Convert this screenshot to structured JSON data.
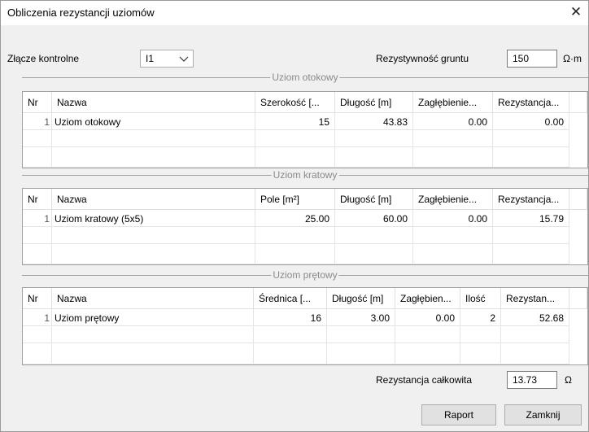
{
  "window": {
    "title": "Obliczenia rezystancji uziomów",
    "close_glyph": "✕"
  },
  "top": {
    "joint_label": "Złącze kontrolne",
    "joint_value": "I1",
    "resistivity_label": "Rezystywność gruntu",
    "resistivity_value": "150",
    "resistivity_unit": "Ω·m"
  },
  "otokowy": {
    "caption": "Uziom otokowy",
    "headers": [
      "Nr",
      "Nazwa",
      "Szerokość [...",
      "Długość [m]",
      "Zagłębienie...",
      "Rezystancja..."
    ],
    "rows": [
      [
        "1",
        "Uziom otokowy",
        "15",
        "43.83",
        "0.00",
        "0.00"
      ]
    ]
  },
  "kratowy": {
    "caption": "Uziom kratowy",
    "headers": [
      "Nr",
      "Nazwa",
      "Pole [m²]",
      "Długość [m]",
      "Zagłębienie...",
      "Rezystancja..."
    ],
    "rows": [
      [
        "1",
        "Uziom kratowy (5x5)",
        "25.00",
        "60.00",
        "0.00",
        "15.79"
      ]
    ]
  },
  "pretowy": {
    "caption": "Uziom prętowy",
    "headers": [
      "Nr",
      "Nazwa",
      "Średnica [...",
      "Długość [m]",
      "Zagłębien...",
      "Ilość",
      "Rezystan..."
    ],
    "rows": [
      [
        "1",
        "Uziom prętowy",
        "16",
        "3.00",
        "0.00",
        "2",
        "52.68"
      ]
    ]
  },
  "total": {
    "label": "Rezystancja całkowita",
    "value": "13.73",
    "unit": "Ω"
  },
  "buttons": {
    "report": "Raport",
    "close": "Zamknij"
  },
  "colors": {
    "window_bg": "#f0f0f0",
    "grid_bg": "#ffffff",
    "border": "#a0a0a0",
    "caption": "#8a8a8a"
  }
}
